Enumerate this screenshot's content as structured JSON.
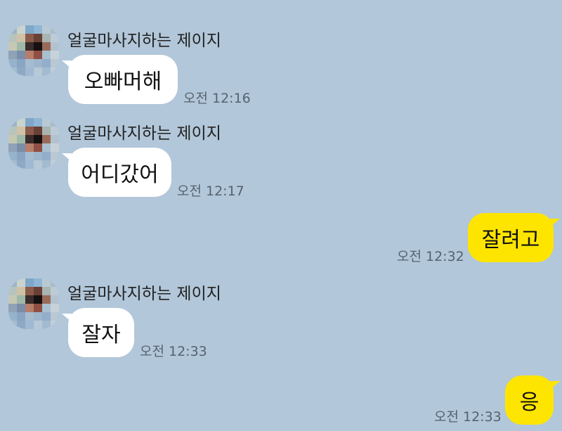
{
  "colors": {
    "background": "#b2c7d9",
    "incoming_bubble": "#ffffff",
    "outgoing_bubble": "#fee500",
    "timestamp": "#556270"
  },
  "messages": [
    {
      "direction": "in",
      "sender": "얼굴마사지하는 제이지",
      "text": "오빠머해",
      "time": "오전 12:16",
      "avatar_icon": "pixelated-profile-photo"
    },
    {
      "direction": "in",
      "sender": "얼굴마사지하는 제이지",
      "text": "어디갔어",
      "time": "오전 12:17",
      "avatar_icon": "pixelated-profile-photo"
    },
    {
      "direction": "out",
      "text": "잘려고",
      "time": "오전 12:32"
    },
    {
      "direction": "in",
      "sender": "얼굴마사지하는 제이지",
      "text": "잘자",
      "time": "오전 12:33",
      "avatar_icon": "pixelated-profile-photo"
    },
    {
      "direction": "out",
      "text": "응",
      "time": "오전 12:33"
    }
  ]
}
